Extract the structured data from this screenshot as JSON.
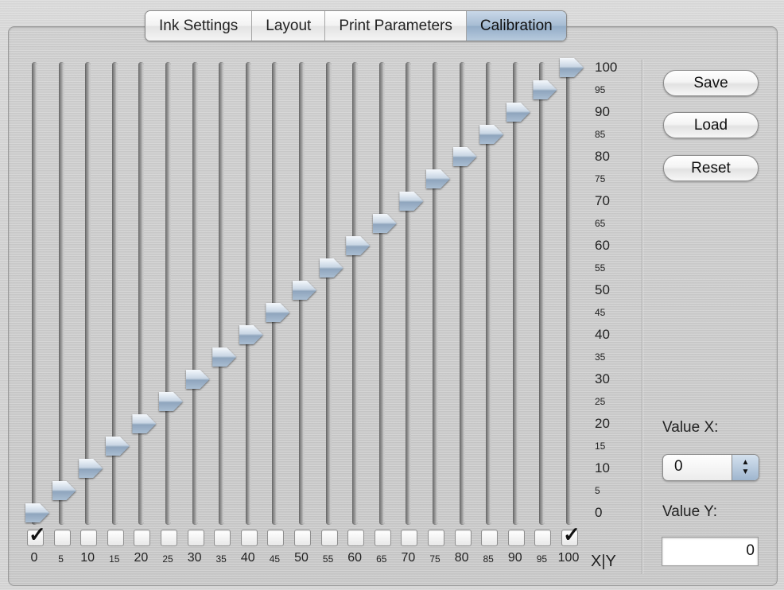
{
  "tabs": [
    {
      "label": "Ink Settings",
      "active": false
    },
    {
      "label": "Layout",
      "active": false
    },
    {
      "label": "Print Parameters",
      "active": false
    },
    {
      "label": "Calibration",
      "active": true
    }
  ],
  "sliders": [
    {
      "x": "0",
      "value": 0,
      "checked": true
    },
    {
      "x": "5",
      "value": 5,
      "checked": false
    },
    {
      "x": "10",
      "value": 10,
      "checked": false
    },
    {
      "x": "15",
      "value": 15,
      "checked": false
    },
    {
      "x": "20",
      "value": 20,
      "checked": false
    },
    {
      "x": "25",
      "value": 25,
      "checked": false
    },
    {
      "x": "30",
      "value": 30,
      "checked": false
    },
    {
      "x": "35",
      "value": 35,
      "checked": false
    },
    {
      "x": "40",
      "value": 40,
      "checked": false
    },
    {
      "x": "45",
      "value": 45,
      "checked": false
    },
    {
      "x": "50",
      "value": 50,
      "checked": false
    },
    {
      "x": "55",
      "value": 55,
      "checked": false
    },
    {
      "x": "60",
      "value": 60,
      "checked": false
    },
    {
      "x": "65",
      "value": 65,
      "checked": false
    },
    {
      "x": "70",
      "value": 70,
      "checked": false
    },
    {
      "x": "75",
      "value": 75,
      "checked": false
    },
    {
      "x": "80",
      "value": 80,
      "checked": false
    },
    {
      "x": "85",
      "value": 85,
      "checked": false
    },
    {
      "x": "90",
      "value": 90,
      "checked": false
    },
    {
      "x": "95",
      "value": 95,
      "checked": false
    },
    {
      "x": "100",
      "value": 100,
      "checked": true
    }
  ],
  "y_axis_labels": [
    "100",
    "95",
    "90",
    "85",
    "80",
    "75",
    "70",
    "65",
    "60",
    "55",
    "50",
    "45",
    "40",
    "35",
    "30",
    "25",
    "20",
    "15",
    "10",
    "5",
    "0"
  ],
  "axis_corner_label": "X|Y",
  "buttons": {
    "save": "Save",
    "load": "Load",
    "reset": "Reset"
  },
  "value_x": {
    "label": "Value X:",
    "value": "0"
  },
  "value_y": {
    "label": "Value Y:",
    "value": "0"
  }
}
